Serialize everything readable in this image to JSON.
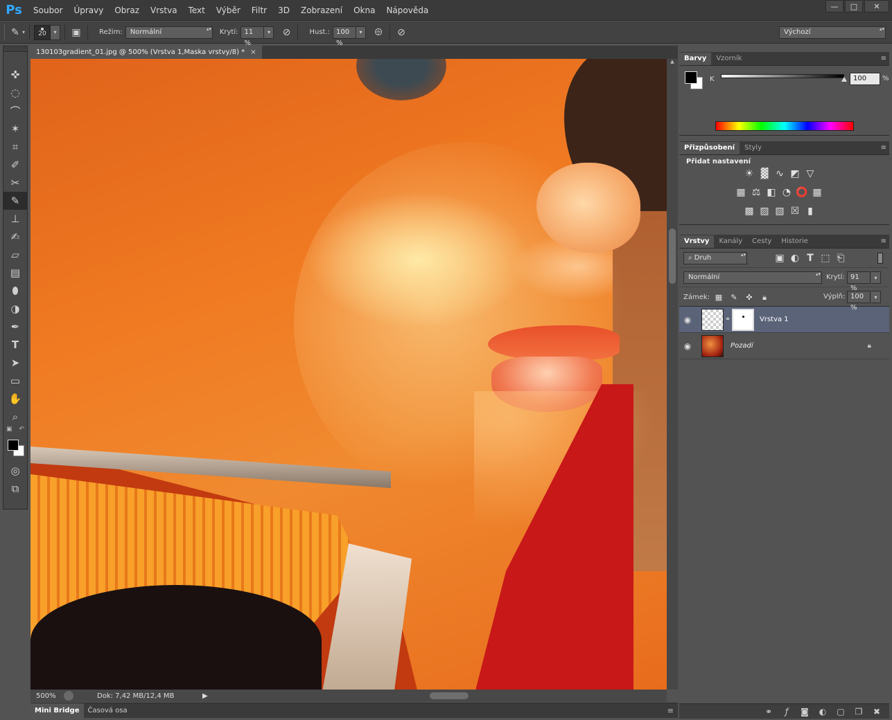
{
  "app": {
    "logo": "Ps"
  },
  "menu": [
    "Soubor",
    "Úpravy",
    "Obraz",
    "Vrstva",
    "Text",
    "Výběr",
    "Filtr",
    "3D",
    "Zobrazení",
    "Okna",
    "Nápověda"
  ],
  "window_controls": {
    "minimize": "—",
    "maximize": "□",
    "close": "✕"
  },
  "options": {
    "brush_size": "20",
    "mode_label": "Režim:",
    "mode_value": "Normální",
    "opacity_label": "Krytí:",
    "opacity_value": "11 %",
    "flow_label": "Hust.:",
    "flow_value": "100 %",
    "workspace": "Výchozí"
  },
  "document": {
    "tab_title": "130103gradient_01.jpg @ 500% (Vrstva 1,Maska vrstvy/8) *",
    "tab_close": "×",
    "zoom": "500%",
    "doc_info": "Dok: 7,42 MB/12,4 MB"
  },
  "bottom_tabs": [
    "Mini Bridge",
    "Časová osa"
  ],
  "colors_panel": {
    "tabs": [
      "Barvy",
      "Vzorník"
    ],
    "channel_label": "K",
    "value": "100",
    "unit": "%"
  },
  "adjustments_panel": {
    "tabs": [
      "Přizpůsobení",
      "Styly"
    ],
    "heading": "Přidat nastavení"
  },
  "layers_panel": {
    "tabs": [
      "Vrstvy",
      "Kanály",
      "Cesty",
      "Historie"
    ],
    "filter_kind": "Druh",
    "blend_mode": "Normální",
    "opacity_label": "Krytí:",
    "opacity_value": "91 %",
    "lock_label": "Zámek:",
    "fill_label": "Výplň:",
    "fill_value": "100 %",
    "layers": [
      {
        "name": "Vrstva 1",
        "selected": true
      },
      {
        "name": "Pozadí",
        "selected": false
      }
    ]
  },
  "colors": {
    "accent": "#31a8ff",
    "selected_layer": "#5a6378",
    "ui_dark": "#3a3a3a",
    "ui_panel": "#535353"
  }
}
